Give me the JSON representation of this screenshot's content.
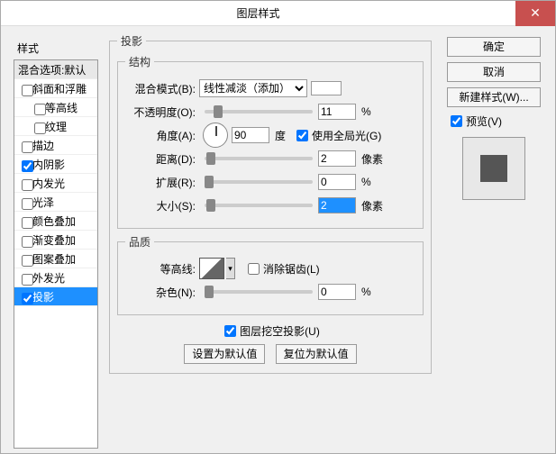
{
  "title": "图层样式",
  "close_glyph": "✕",
  "left": {
    "header": "样式",
    "blend_header": "混合选项:默认",
    "items": [
      {
        "label": "斜面和浮雕",
        "checked": false,
        "indent": false
      },
      {
        "label": "等高线",
        "checked": false,
        "indent": true
      },
      {
        "label": "纹理",
        "checked": false,
        "indent": true
      },
      {
        "label": "描边",
        "checked": false,
        "indent": false
      },
      {
        "label": "内阴影",
        "checked": true,
        "indent": false
      },
      {
        "label": "内发光",
        "checked": false,
        "indent": false
      },
      {
        "label": "光泽",
        "checked": false,
        "indent": false
      },
      {
        "label": "颜色叠加",
        "checked": false,
        "indent": false
      },
      {
        "label": "渐变叠加",
        "checked": false,
        "indent": false
      },
      {
        "label": "图案叠加",
        "checked": false,
        "indent": false
      },
      {
        "label": "外发光",
        "checked": false,
        "indent": false
      },
      {
        "label": "投影",
        "checked": true,
        "indent": false,
        "selected": true
      }
    ]
  },
  "main": {
    "fieldset_main": "投影",
    "group_struct": "结构",
    "blend_mode_label": "混合模式(B):",
    "blend_mode_value": "线性减淡（添加）",
    "opacity_label": "不透明度(O):",
    "opacity_value": "11",
    "opacity_unit": "%",
    "angle_label": "角度(A):",
    "angle_value": "90",
    "angle_unit": "度",
    "use_global": "使用全局光(G)",
    "distance_label": "距离(D):",
    "distance_value": "2",
    "distance_unit": "像素",
    "spread_label": "扩展(R):",
    "spread_value": "0",
    "spread_unit": "%",
    "size_label": "大小(S):",
    "size_value": "2",
    "size_unit": "像素",
    "group_quality": "品质",
    "contour_label": "等高线:",
    "antialias": "消除锯齿(L)",
    "noise_label": "杂色(N):",
    "noise_value": "0",
    "noise_unit": "%",
    "knockout": "图层挖空投影(U)",
    "btn_defaults": "设置为默认值",
    "btn_reset": "复位为默认值"
  },
  "right": {
    "ok": "确定",
    "cancel": "取消",
    "new_style": "新建样式(W)...",
    "preview": "预览(V)"
  }
}
